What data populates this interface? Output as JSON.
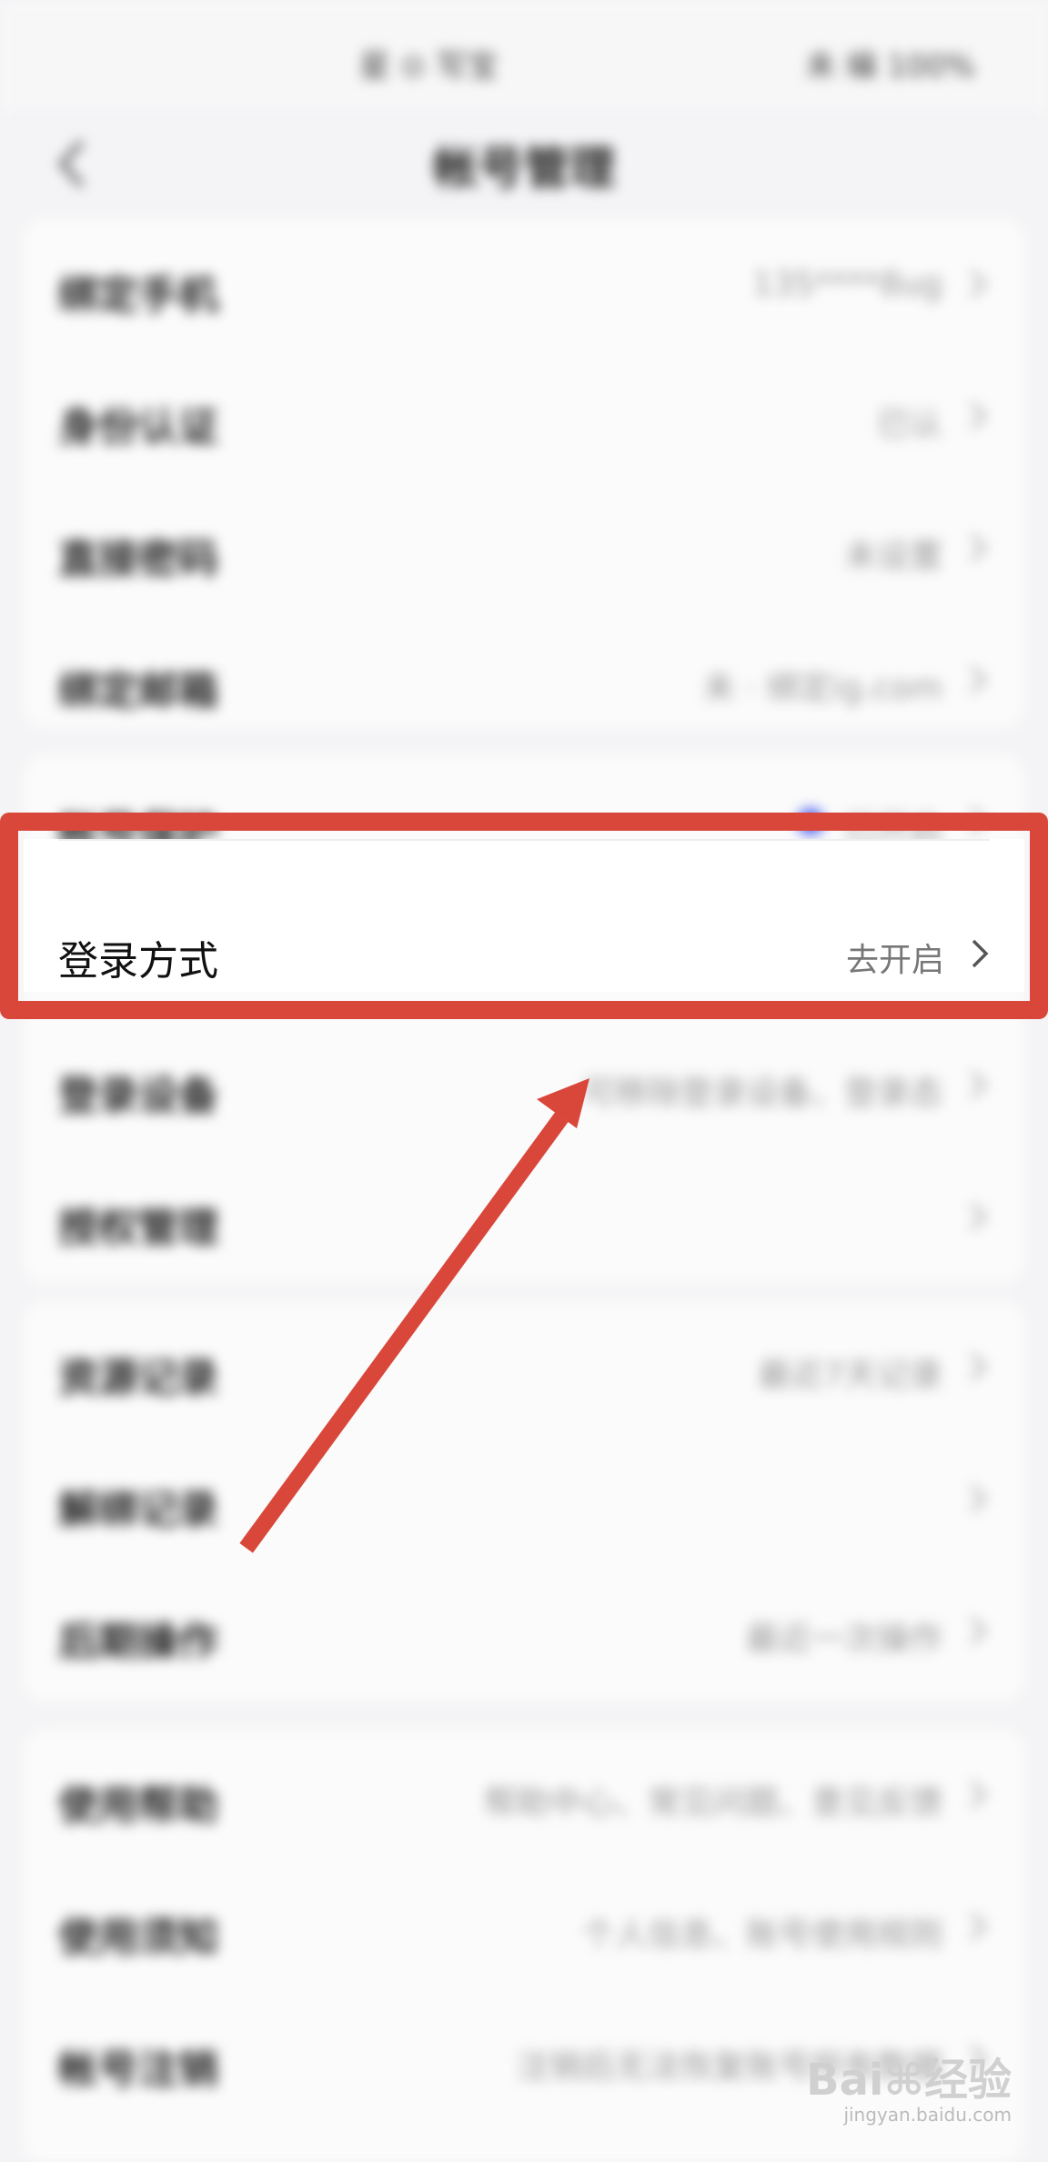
{
  "status_bar": {
    "center_text": "星 ⊙ 写宝",
    "right_text": "未 编 100%"
  },
  "nav": {
    "title": "帐号管理"
  },
  "groups": [
    {
      "rows": [
        {
          "label": "绑定手机",
          "value": "135****8ug"
        },
        {
          "label": "身份认证",
          "value": "已认"
        },
        {
          "label": "直接密码",
          "value": "未设置"
        },
        {
          "label": "绑定邮箱",
          "value": "未 · 绑定ig.com"
        }
      ]
    },
    {
      "rows": [
        {
          "label": "帐号保护",
          "value": "已开启"
        },
        {
          "label": "登录设备",
          "value": "可移除登录设备、登录态"
        },
        {
          "label": "授权管理",
          "value": ""
        }
      ]
    },
    {
      "rows": [
        {
          "label": "资源记录",
          "value": "最近7天记录"
        },
        {
          "label": "解绑记录",
          "value": ""
        },
        {
          "label": "后期操作",
          "value": "最近一次操作"
        }
      ]
    },
    {
      "rows": [
        {
          "label": "使用帮助",
          "value": "帮助中心、常见问题、意见反馈"
        },
        {
          "label": "使用须知",
          "value": "个人信息、账号使用规则"
        },
        {
          "label": "帐号注销",
          "value": "注销后无法恢复账号所有数据"
        }
      ]
    }
  ],
  "highlighted_row": {
    "label": "登录方式",
    "value": "去开启"
  },
  "watermark": {
    "main": "Bai⌘经验",
    "sub": "jingyan.baidu.com"
  },
  "colors": {
    "highlight": "#d9473b",
    "toggle_dot": "#5a6af0"
  }
}
